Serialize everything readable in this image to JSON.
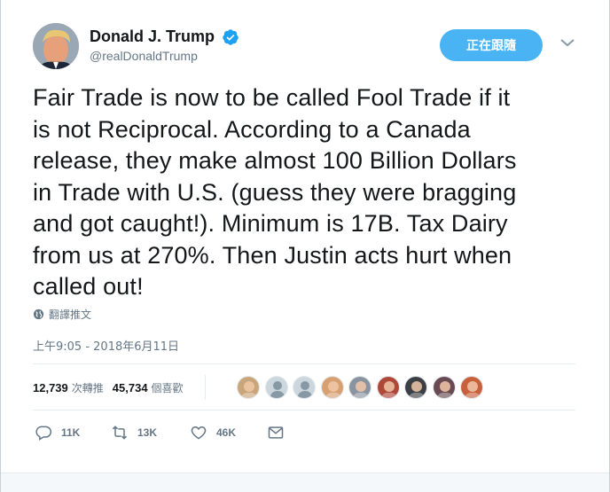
{
  "user": {
    "display_name": "Donald J. Trump",
    "handle": "@realDonaldTrump",
    "verified": true
  },
  "follow_button": {
    "label": "正在跟隨"
  },
  "tweet": {
    "lines": [
      "Fair Trade is now to be called Fool Trade if it",
      "is not Reciprocal. According to a Canada",
      "release, they make almost 100 Billion Dollars",
      "in Trade with U.S. (guess they were bragging",
      "and got caught!). Minimum is 17B. Tax Dairy",
      "from us at 270%. Then Justin acts hurt when",
      "called out!"
    ],
    "translate_label": "翻譯推文",
    "timestamp": "上午9:05 - 2018年6月11日"
  },
  "stats": {
    "retweets_count": "12,739",
    "retweets_label": "次轉推",
    "likes_count": "45,734",
    "likes_label": "個喜歡"
  },
  "likers": [
    {
      "icon": "user-avatar",
      "color": "#c9a57a"
    },
    {
      "icon": "default-avatar",
      "color": "#ccd6dd"
    },
    {
      "icon": "default-avatar",
      "color": "#ccd6dd"
    },
    {
      "icon": "user-avatar",
      "color": "#d8a070"
    },
    {
      "icon": "user-avatar",
      "color": "#8a93a0"
    },
    {
      "icon": "user-avatar",
      "color": "#b0483a"
    },
    {
      "icon": "user-avatar",
      "color": "#3c3f45"
    },
    {
      "icon": "user-avatar",
      "color": "#6a4a52"
    },
    {
      "icon": "user-avatar",
      "color": "#c8603c"
    }
  ],
  "actions": {
    "reply_count": "11K",
    "retweet_count": "13K",
    "like_count": "46K"
  },
  "colors": {
    "accent": "#4ab3f4",
    "verified": "#1da1f2",
    "secondary_text": "#657786"
  }
}
